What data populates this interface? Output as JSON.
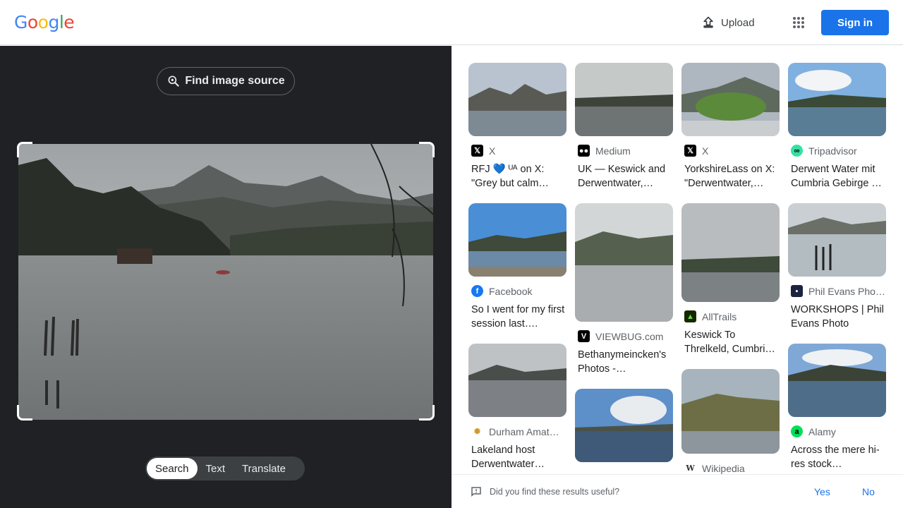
{
  "header": {
    "logo": "Google",
    "upload_label": "Upload",
    "signin_label": "Sign in",
    "colors": {
      "blue": "#4285F4",
      "red": "#EA4335",
      "yellow": "#FBBC05",
      "green": "#34A853",
      "signin_bg": "#1a73e8"
    }
  },
  "left": {
    "find_source_label": "Find image source",
    "modes": [
      "Search",
      "Text",
      "Translate"
    ],
    "active_mode": "Search"
  },
  "results": {
    "columns": [
      [
        {
          "source": "X",
          "icon": "x-logo-icon",
          "title": "RFJ 💙 ᵁᴬ on X: \"Grey but calm…"
        },
        {
          "source": "Facebook",
          "icon": "facebook-icon",
          "title": "So I went for my first session last…."
        },
        {
          "source": "Durham Amat…",
          "icon": "durham-icon",
          "title": "Lakeland host Derwentwater…"
        }
      ],
      [
        {
          "source": "Medium",
          "icon": "medium-icon",
          "title": "UK — Keswick and Derwentwater,…"
        },
        {
          "source": "VIEWBUG.com",
          "icon": "viewbug-icon",
          "title": "Bethanymeincken's Photos -…"
        },
        {
          "source": "",
          "icon": "",
          "title": ""
        }
      ],
      [
        {
          "source": "X",
          "icon": "x-logo-icon",
          "title": "YorkshireLass on X: \"Derwentwater,…"
        },
        {
          "source": "AllTrails",
          "icon": "alltrails-icon",
          "title": "Keswick To Threlkeld, Cumbri…"
        },
        {
          "source": "Wikipedia",
          "icon": "wikipedia-icon",
          "title": ""
        }
      ],
      [
        {
          "source": "Tripadvisor",
          "icon": "tripadvisor-icon",
          "title": "Derwent Water mit Cumbria Gebirge …"
        },
        {
          "source": "Phil Evans Pho…",
          "icon": "phil-evans-icon",
          "title": "WORKSHOPS | Phil Evans Photo"
        },
        {
          "source": "Alamy",
          "icon": "alamy-icon",
          "title": "Across the mere hi-res stock…"
        }
      ]
    ]
  },
  "feedback": {
    "question": "Did you find these results useful?",
    "yes": "Yes",
    "no": "No"
  }
}
